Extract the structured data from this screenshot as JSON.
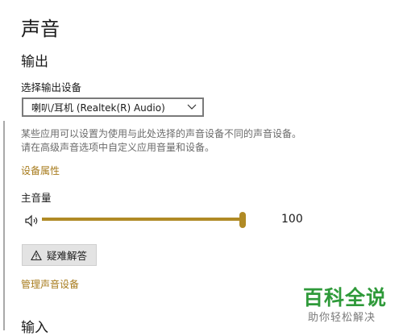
{
  "page": {
    "title": "声音"
  },
  "output": {
    "heading": "输出",
    "device_label": "选择输出设备",
    "selected_device": "喇叭/耳机 (Realtek(R) Audio)",
    "description_line1": "某些应用可以设置为使用与此处选择的声音设备不同的声音设备。",
    "description_line2": "请在高级声音选项中自定义应用音量和设备。",
    "device_properties_link": "设备属性",
    "volume_label": "主音量",
    "volume_value": "100",
    "volume_level": 100,
    "troubleshoot_label": "疑难解答",
    "manage_devices_link": "管理声音设备"
  },
  "input": {
    "heading": "输入"
  },
  "watermark": {
    "title": "百科全说",
    "subtitle": "助你轻松解决"
  },
  "colors": {
    "accent": "#b08a25",
    "link": "#a77b1c",
    "watermark_green": "#2f9a3a"
  },
  "icons": {
    "dropdown": "chevron-down-icon",
    "speaker": "speaker-icon",
    "troubleshoot": "warning-icon"
  }
}
